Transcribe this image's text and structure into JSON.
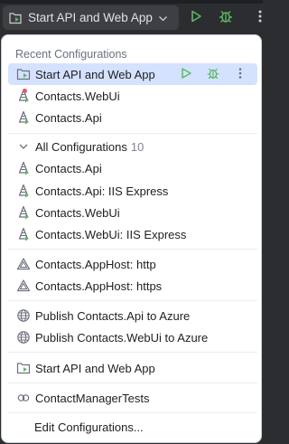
{
  "toolbar": {
    "run_config_label": "Start API and Web App",
    "run_icon": "run-icon",
    "debug_icon": "debug-icon",
    "more_icon": "more-vertical-icon"
  },
  "colors": {
    "run_green": "#5fb865",
    "selected_bg": "#d4e2ff",
    "toolbar_bg": "#2b2d30",
    "error_dot": "#e55765"
  },
  "popup": {
    "recent_title": "Recent Configurations",
    "recent": [
      {
        "label": "Start API and Web App",
        "icon": "compound-config-icon",
        "selected": true
      },
      {
        "label": "Contacts.WebUi",
        "icon": "dotnet-project-icon",
        "error": true
      },
      {
        "label": "Contacts.Api",
        "icon": "dotnet-project-icon"
      }
    ],
    "all_group": {
      "label": "All Configurations",
      "count": "10",
      "expanded": true
    },
    "all_items": [
      {
        "label": "Contacts.Api",
        "icon": "dotnet-project-icon"
      },
      {
        "label": "Contacts.Api: IIS Express",
        "icon": "dotnet-project-icon"
      },
      {
        "label": "Contacts.WebUi",
        "icon": "dotnet-project-icon"
      },
      {
        "label": "Contacts.WebUi: IIS Express",
        "icon": "dotnet-project-icon"
      }
    ],
    "apphost_items": [
      {
        "label": "Contacts.AppHost: http",
        "icon": "aspire-icon"
      },
      {
        "label": "Contacts.AppHost: https",
        "icon": "aspire-icon"
      }
    ],
    "publish_items": [
      {
        "label": "Publish Contacts.Api to Azure",
        "icon": "globe-icon"
      },
      {
        "label": "Publish Contacts.WebUi to Azure",
        "icon": "globe-icon"
      }
    ],
    "compound_items": [
      {
        "label": "Start API and Web App",
        "icon": "compound-config-icon"
      }
    ],
    "test_items": [
      {
        "label": "ContactManagerTests",
        "icon": "test-config-icon"
      }
    ],
    "edit_label": "Edit Configurations..."
  }
}
